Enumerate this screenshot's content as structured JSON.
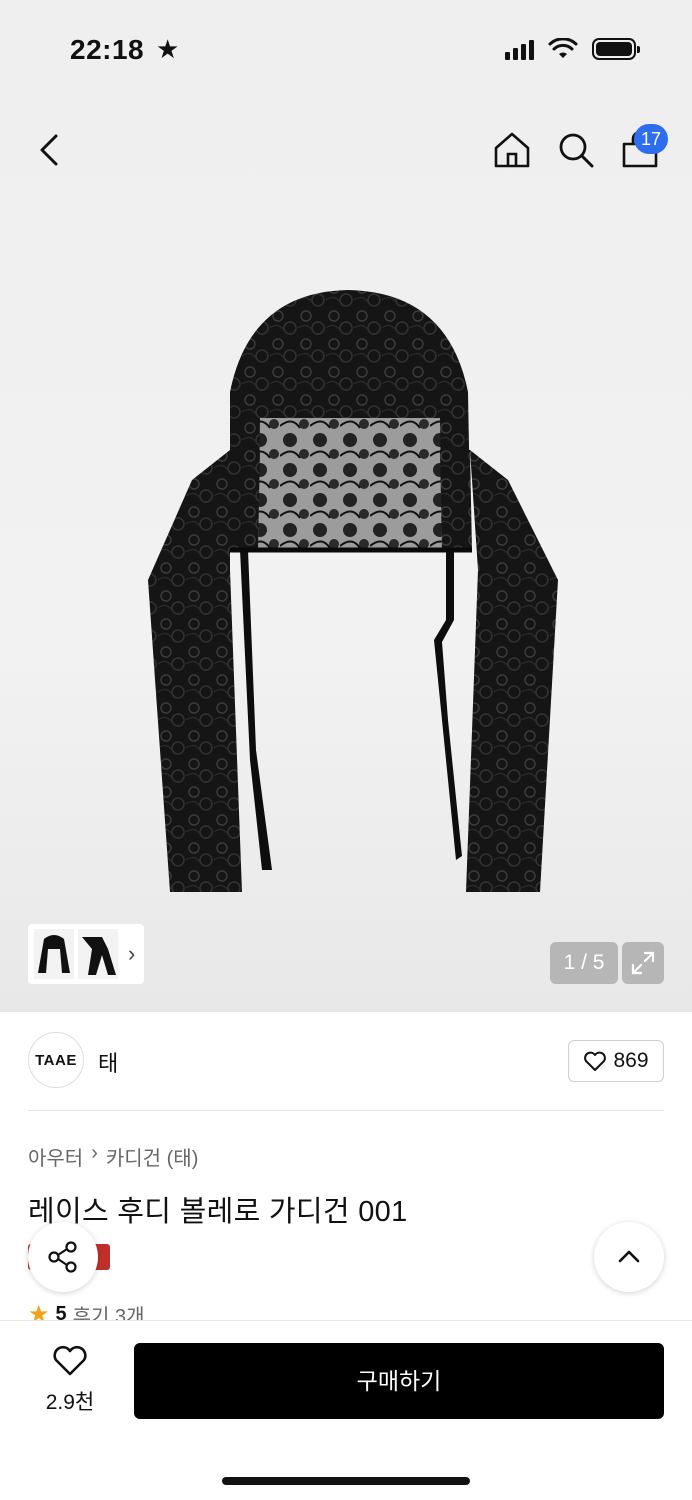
{
  "status_bar": {
    "time": "22:18",
    "star": "★"
  },
  "nav": {
    "cart_count": "17"
  },
  "gallery": {
    "page_counter": "1 / 5",
    "current_page": 1,
    "total_pages": 5
  },
  "brand": {
    "logo_text": "TAAE",
    "name": "태",
    "like_count": "869"
  },
  "breadcrumb": {
    "category": "아우터",
    "separator": "›",
    "subcategory": "카디건 (태)"
  },
  "product": {
    "title": "레이스 후디 볼레로 가디건 001"
  },
  "rating": {
    "star": "★",
    "score": "5",
    "reviews": "후기 3개"
  },
  "bottom_bar": {
    "wish_count": "2.9천",
    "buy_label": "구매하기"
  },
  "colors": {
    "accent_blue": "#2f6df0",
    "sale_red": "#c0302a",
    "star_orange": "#f6a11c"
  }
}
